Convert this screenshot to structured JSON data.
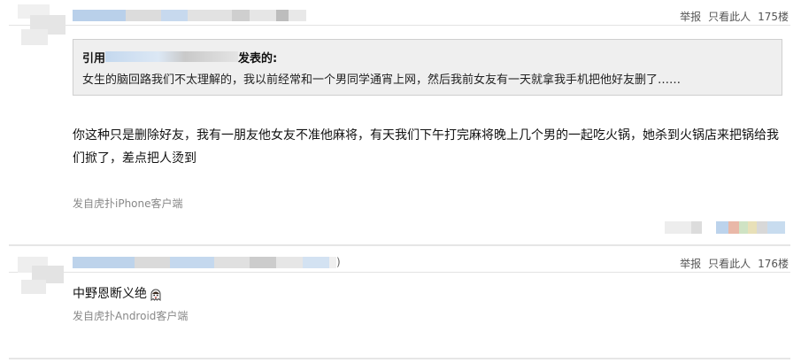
{
  "posts": [
    {
      "floor": "175楼",
      "report_label": "举报",
      "only_view_label": "只看此人",
      "quote": {
        "prefix": "引用",
        "suffix": "发表的:",
        "text": "女生的脑回路我们不太理解的，我以前经常和一个男同学通宵上网，然后我前女友有一天就拿我手机把他好友删了……"
      },
      "content": "你这种只是删除好友，我有一朋友他女友不准他麻将，有天我们下午打完麻将晚上几个男的一起吃火锅，她杀到火锅店来把锅给我们掀了，差点把人烫到",
      "source": "发自虎扑iPhone客户端"
    },
    {
      "floor": "176楼",
      "report_label": "举报",
      "only_view_label": "只看此人",
      "username_tail": ")",
      "content": "中野恩断义绝",
      "source": "发自虎扑Android客户端"
    }
  ],
  "colors": {
    "blur_blue": "#a9c6e6",
    "blur_gray": "#d9d9d9",
    "quote_bg": "#efefef"
  }
}
